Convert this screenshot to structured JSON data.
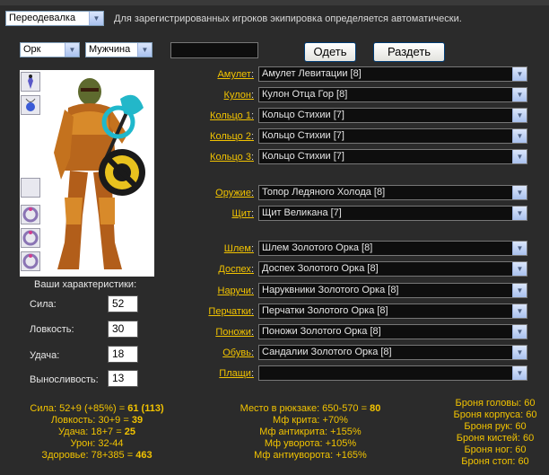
{
  "header": {
    "mode_select": "Переодевалка",
    "info_text": "Для зарегистрированных игроков экипировка определяется автоматически."
  },
  "controls": {
    "race": "Орк",
    "gender": "Мужчина",
    "name_value": "",
    "dress_button": "Одеть",
    "undress_button": "Раздеть"
  },
  "slots": [
    {
      "label": "Амулет",
      "value": "Амулет Левитации [8]"
    },
    {
      "label": "Кулон",
      "value": "Кулон Отца Гор [8]"
    },
    {
      "label": "Кольцо 1",
      "value": "Кольцо Стихии [7]"
    },
    {
      "label": "Кольцо 2",
      "value": "Кольцо Стихии [7]"
    },
    {
      "label": "Кольцо 3",
      "value": "Кольцо Стихии [7]"
    },
    {
      "label": "Оружие",
      "value": "Топор Ледяного Холода [8]"
    },
    {
      "label": "Щит",
      "value": "Щит Великана [7]"
    },
    {
      "label": "Шлем",
      "value": "Шлем Золотого Орка [8]"
    },
    {
      "label": "Доспех",
      "value": "Доспех Золотого Орка [8]"
    },
    {
      "label": "Наручи",
      "value": "Наруквники Золотого Орка [8]"
    },
    {
      "label": "Перчатки",
      "value": "Перчатки Золотого Орка [8]"
    },
    {
      "label": "Поножи",
      "value": "Поножи Золотого Орка [8]"
    },
    {
      "label": "Обувь",
      "value": "Сандалии Золотого Орка [8]"
    },
    {
      "label": "Плащи",
      "value": ""
    }
  ],
  "stats": {
    "title": "Ваши характеристики:",
    "strength_label": "Сила:",
    "strength": "52",
    "agility_label": "Ловкость:",
    "agility": "30",
    "luck_label": "Удача:",
    "luck": "18",
    "endurance_label": "Выносливость:",
    "endurance": "13"
  },
  "summary_left": {
    "str_prefix": "Сила: 52+9 (+85%) = ",
    "str_value": "61 (113)",
    "agi_prefix": "Ловкость: 30+9 = ",
    "agi_value": "39",
    "luck_prefix": "Удача: 18+7 = ",
    "luck_value": "25",
    "damage": "Урон: 32-44",
    "hp_prefix": "Здоровье: 78+385 = ",
    "hp_value": "463"
  },
  "summary_mid": {
    "bag_prefix": "Место в рюкзаке: 650-570 = ",
    "bag_value": "80",
    "crit": "Мф крита: +70%",
    "anticrit": "Мф антикрита: +155%",
    "dodge": "Мф уворота: +105%",
    "antidodge": "Мф антиуворота: +165%"
  },
  "summary_right": {
    "head": "Броня головы: 60",
    "body": "Броня корпуса: 60",
    "arms": "Броня рук: 60",
    "hands": "Броня кистей: 60",
    "legs": "Броня ног: 60",
    "feet": "Броня стоп: 60"
  }
}
